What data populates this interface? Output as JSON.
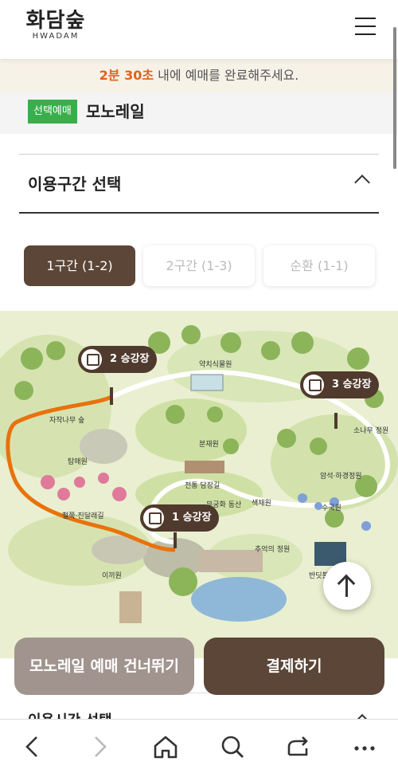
{
  "header": {
    "logo_ko": "화담숲",
    "logo_en": "HWADAM",
    "menu_icon": "hamburger-menu-icon"
  },
  "timer": {
    "time": "2분 30초",
    "message": " 내에 예매를 완료해주세요."
  },
  "selected": {
    "badge": "선택예매",
    "name": "모노레일"
  },
  "section": {
    "title": "이용구간 선택"
  },
  "routes": [
    {
      "label": "1구간 (1-2)",
      "active": true
    },
    {
      "label": "2구간 (1-3)",
      "active": false
    },
    {
      "label": "순환 (1-1)",
      "active": false
    }
  ],
  "map": {
    "stations": [
      "2 승강장",
      "3 승강장",
      "1 승강장"
    ],
    "labels": [
      "약치식물원",
      "자작나무 숲",
      "탐매원",
      "분재원",
      "소나무 정원",
      "암석·하경정원",
      "전통 담장길",
      "무궁화 동산",
      "색채원",
      "수국원",
      "철쭉·진달래길",
      "추억의 정원",
      "이끼원",
      "반딧불"
    ]
  },
  "actions": {
    "skip": "모노레일 예매 건너뛰기",
    "pay": "결제하기"
  },
  "below": {
    "title": "이용시간 선택"
  },
  "browser": {
    "icons": [
      "back-icon",
      "forward-icon",
      "home-icon",
      "search-icon",
      "share-icon",
      "more-icon"
    ]
  },
  "colors": {
    "brand_brown": "#5b4637",
    "timer_orange": "#e0621c",
    "badge_green": "#3aae4c"
  }
}
